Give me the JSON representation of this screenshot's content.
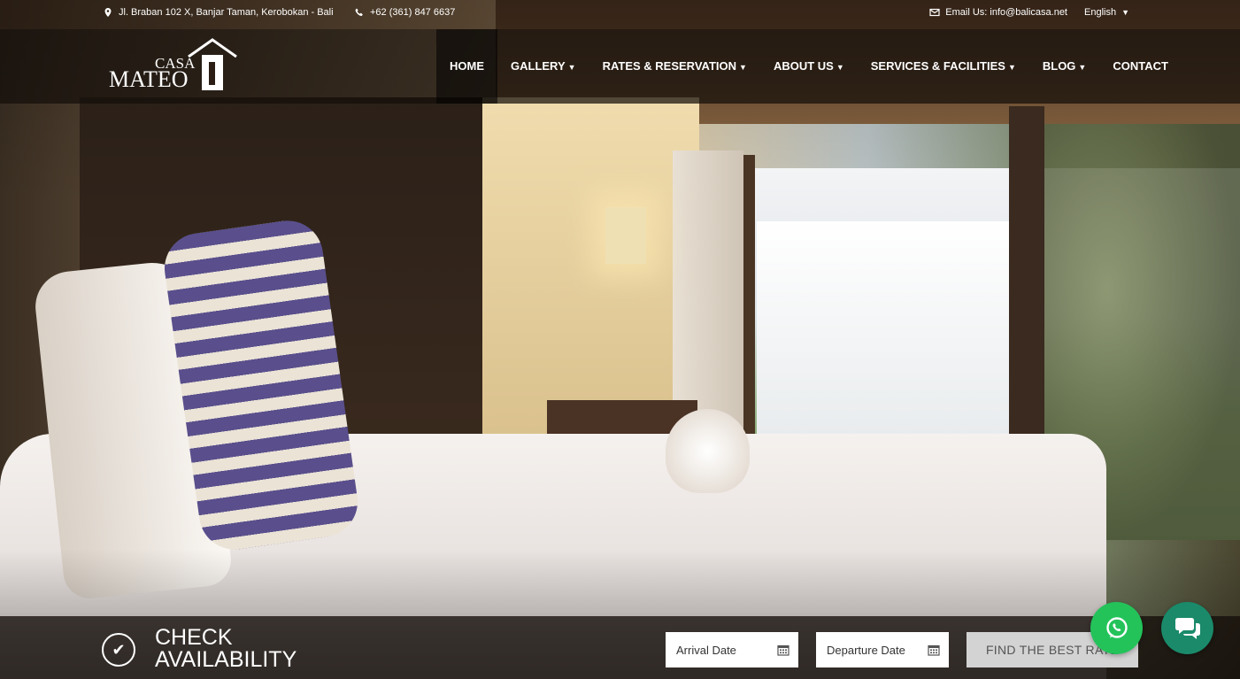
{
  "topbar": {
    "address": "Jl. Braban 102 X, Banjar Taman, Kerobokan - Bali",
    "phone": "+62 (361) 847 6637",
    "email": "Email Us: info@balicasa.net",
    "language": "English"
  },
  "logo": {
    "casa": "CASA",
    "mateo": "MATEO"
  },
  "nav": {
    "items": [
      {
        "label": "HOME",
        "active": true
      },
      {
        "label": "GALLERY",
        "dropdown": true
      },
      {
        "label": "RATES & RESERVATION",
        "dropdown": true
      },
      {
        "label": "ABOUT US",
        "dropdown": true
      },
      {
        "label": "SERVICES & FACILITIES",
        "dropdown": true
      },
      {
        "label": "BLOG",
        "dropdown": true
      },
      {
        "label": "CONTACT"
      }
    ]
  },
  "availability": {
    "title_line1": "CHECK",
    "title_line2": "AVAILABILITY",
    "arrival_placeholder": "Arrival Date",
    "departure_placeholder": "Departure Date",
    "button_label": "FIND THE BEST RATE"
  },
  "colors": {
    "whatsapp": "#23c35a",
    "chat": "#1a8a6a",
    "button_bg": "#d3d3d3"
  },
  "icons": [
    "map-marker-icon",
    "phone-icon",
    "envelope-icon",
    "caret-down-icon",
    "check-circle-icon",
    "calendar-icon",
    "whatsapp-icon",
    "chat-icon"
  ]
}
